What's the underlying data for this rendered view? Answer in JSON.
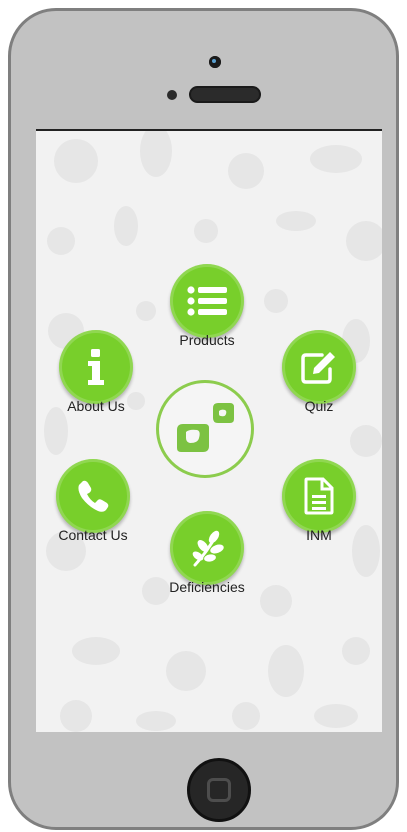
{
  "menu": {
    "products": {
      "label": "Products",
      "icon": "list-icon"
    },
    "about": {
      "label": "About Us",
      "icon": "info-icon"
    },
    "quiz": {
      "label": "Quiz",
      "icon": "edit-icon"
    },
    "contact": {
      "label": "Contact Us",
      "icon": "phone-icon"
    },
    "inm": {
      "label": "INM",
      "icon": "document-icon"
    },
    "deficiencies": {
      "label": "Deficiencies",
      "icon": "leaf-icon"
    }
  },
  "logo": {
    "icon": "app-logo-icon"
  },
  "colors": {
    "accent": "#78cf2b",
    "logo_green": "#8ccc4d",
    "screen_bg": "#f2f2f2",
    "phone_body": "#c2c2c2"
  }
}
